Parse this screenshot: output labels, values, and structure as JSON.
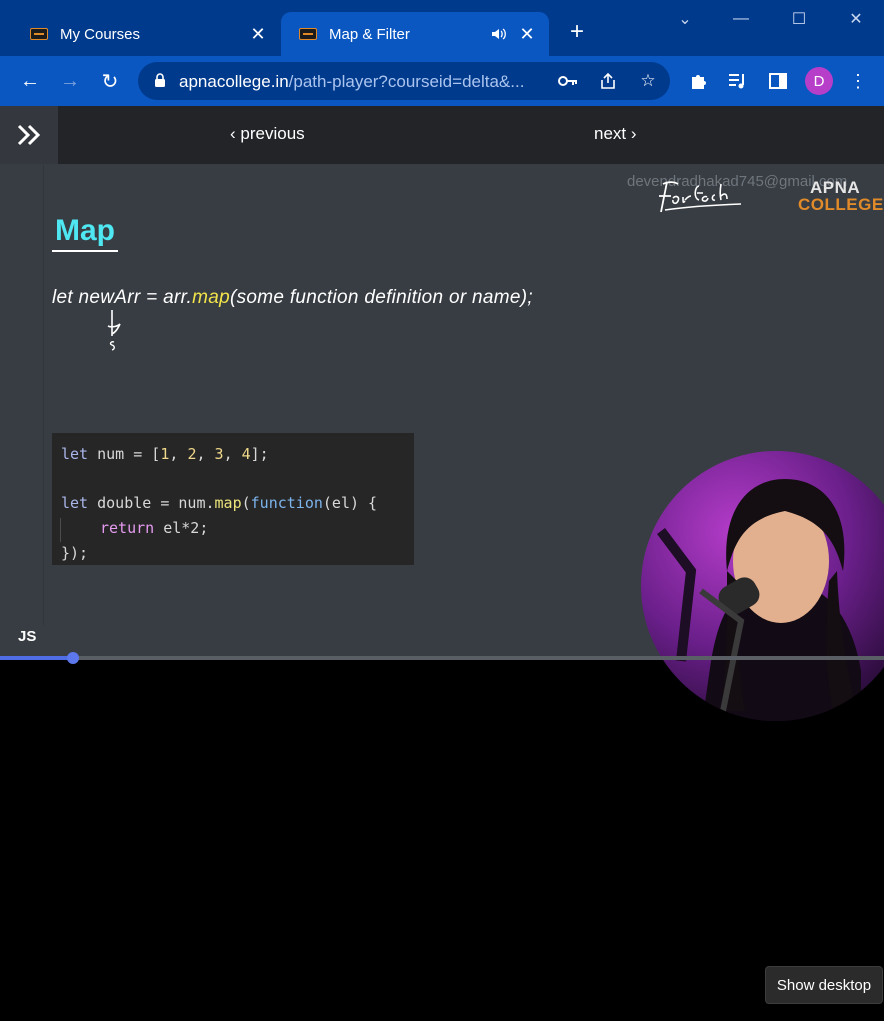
{
  "browser": {
    "tabs": [
      {
        "title": "My Courses",
        "active": false
      },
      {
        "title": "Map & Filter",
        "active": true
      }
    ],
    "address": {
      "domain": "apnacollege.in",
      "path": "/path-player?courseid=delta&..."
    },
    "profile_initial": "D",
    "colors": {
      "tab_strip": "#003a8c",
      "toolbar": "#0a57c2",
      "avatar": "#b63ec8"
    }
  },
  "player": {
    "previous_label": "previous",
    "next_label": "next",
    "progress_fraction": 0.08,
    "accent": "#4f6ee6"
  },
  "slide": {
    "watermark": "devendradhakad745@gmail.com",
    "logo_line1": "APNA",
    "logo_line2": "COLLEGE",
    "handwriting": "for Each",
    "title": "Map",
    "syntax_pre": "let newArr = arr.",
    "syntax_method": "map",
    "syntax_post": "(some function definition or name);",
    "code": {
      "line1_kw": "let",
      "line1_rest": " num = [",
      "nums": [
        "1",
        "2",
        "3",
        "4"
      ],
      "line3_kw": "let",
      "line3_var": " double = num.",
      "line3_fn": "map",
      "line3_open": "(",
      "line3_fk": "function",
      "line3_rest": "(el) {",
      "line4_kw": "return",
      "line4_rest": " el*2;",
      "line5": "});"
    },
    "footer_label": "JS"
  },
  "tooltip": "Show desktop"
}
